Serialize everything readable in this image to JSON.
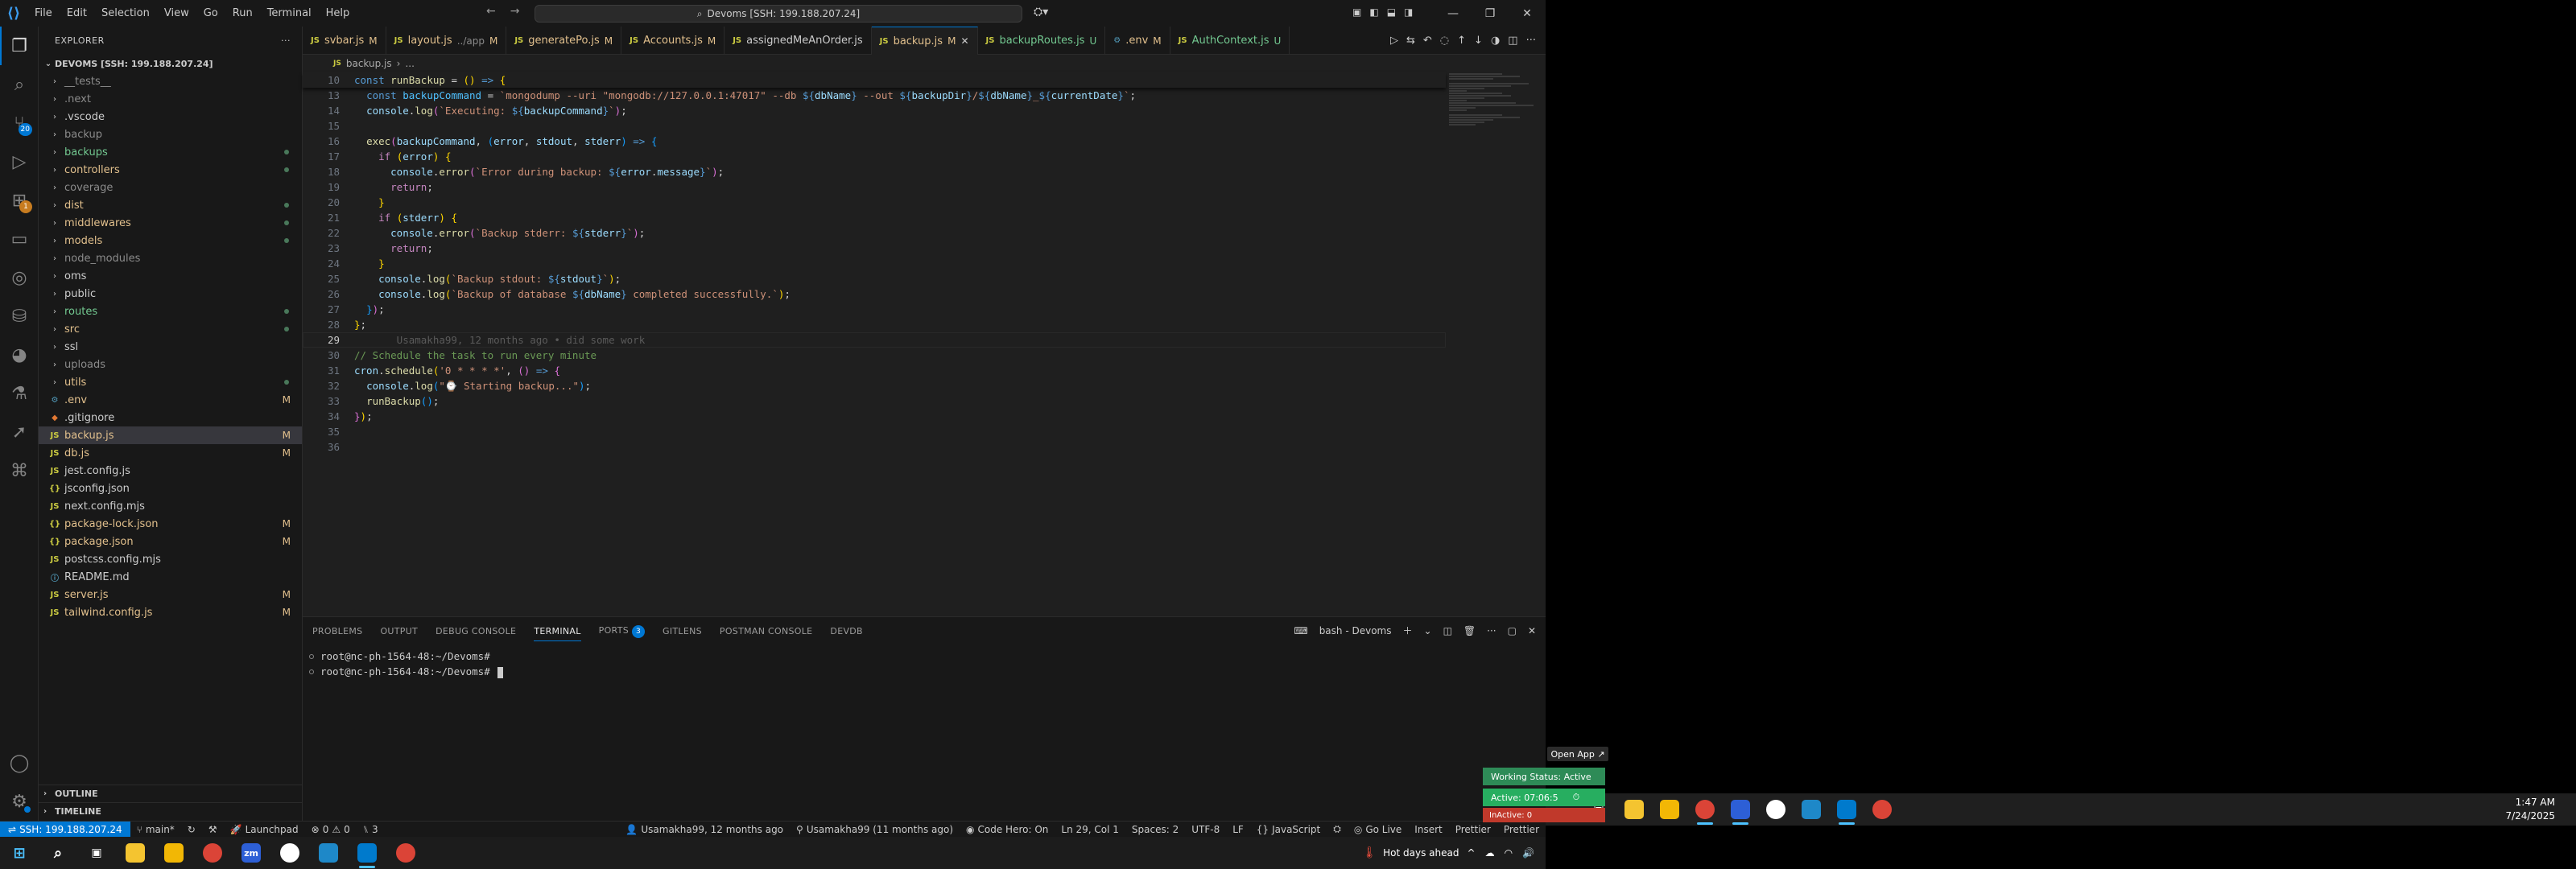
{
  "titlebar": {
    "menus": [
      "File",
      "Edit",
      "Selection",
      "View",
      "Go",
      "Run",
      "Terminal",
      "Help"
    ],
    "command_center": "Devoms [SSH: 199.188.207.24]"
  },
  "activity": {
    "source_control_badge": "20",
    "extensions_badge": "1"
  },
  "explorer": {
    "title": "EXPLORER",
    "root": "DEVOMS [SSH: 199.188.207.24]",
    "items": [
      {
        "type": "folder",
        "name": "__tests__",
        "color": "#8b8b8b",
        "status": ""
      },
      {
        "type": "folder",
        "name": ".next",
        "color": "#8b8b8b",
        "status": ""
      },
      {
        "type": "folder",
        "name": ".vscode",
        "color": "#cccccc",
        "status": ""
      },
      {
        "type": "folder",
        "name": "backup",
        "color": "#8b8b8b",
        "status": ""
      },
      {
        "type": "folder",
        "name": "backups",
        "color": "#73c991",
        "status": "dot"
      },
      {
        "type": "folder",
        "name": "controllers",
        "color": "#e2c08d",
        "status": "dot"
      },
      {
        "type": "folder",
        "name": "coverage",
        "color": "#8b8b8b",
        "status": ""
      },
      {
        "type": "folder",
        "name": "dist",
        "color": "#e2c08d",
        "status": "dot"
      },
      {
        "type": "folder",
        "name": "middlewares",
        "color": "#e2c08d",
        "status": "dot"
      },
      {
        "type": "folder",
        "name": "models",
        "color": "#e2c08d",
        "status": "dot"
      },
      {
        "type": "folder",
        "name": "node_modules",
        "color": "#8b8b8b",
        "status": ""
      },
      {
        "type": "folder",
        "name": "oms",
        "color": "#cccccc",
        "status": ""
      },
      {
        "type": "folder",
        "name": "public",
        "color": "#cccccc",
        "status": ""
      },
      {
        "type": "folder",
        "name": "routes",
        "color": "#73c991",
        "status": "dot"
      },
      {
        "type": "folder",
        "name": "src",
        "color": "#e2c08d",
        "status": "dot"
      },
      {
        "type": "folder",
        "name": "ssl",
        "color": "#cccccc",
        "status": ""
      },
      {
        "type": "folder",
        "name": "uploads",
        "color": "#8b8b8b",
        "status": ""
      },
      {
        "type": "folder",
        "name": "utils",
        "color": "#e2c08d",
        "status": "dot"
      },
      {
        "type": "file",
        "name": ".env",
        "icon": "⚙",
        "icon_color": "#519aba",
        "color": "#e2c08d",
        "status": "M"
      },
      {
        "type": "file",
        "name": ".gitignore",
        "icon": "◆",
        "icon_color": "#e37933",
        "color": "#cccccc",
        "status": ""
      },
      {
        "type": "file",
        "name": "backup.js",
        "icon": "JS",
        "icon_color": "#cbcb41",
        "color": "#e2c08d",
        "status": "M",
        "selected": true
      },
      {
        "type": "file",
        "name": "db.js",
        "icon": "JS",
        "icon_color": "#cbcb41",
        "color": "#e2c08d",
        "status": "M"
      },
      {
        "type": "file",
        "name": "jest.config.js",
        "icon": "JS",
        "icon_color": "#cbcb41",
        "color": "#cccccc",
        "status": ""
      },
      {
        "type": "file",
        "name": "jsconfig.json",
        "icon": "{}",
        "icon_color": "#cbcb41",
        "color": "#cccccc",
        "status": ""
      },
      {
        "type": "file",
        "name": "next.config.mjs",
        "icon": "JS",
        "icon_color": "#cbcb41",
        "color": "#cccccc",
        "status": ""
      },
      {
        "type": "file",
        "name": "package-lock.json",
        "icon": "{}",
        "icon_color": "#cbcb41",
        "color": "#e2c08d",
        "status": "M"
      },
      {
        "type": "file",
        "name": "package.json",
        "icon": "{}",
        "icon_color": "#cbcb41",
        "color": "#e2c08d",
        "status": "M"
      },
      {
        "type": "file",
        "name": "postcss.config.mjs",
        "icon": "JS",
        "icon_color": "#cbcb41",
        "color": "#cccccc",
        "status": ""
      },
      {
        "type": "file",
        "name": "README.md",
        "icon": "ⓘ",
        "icon_color": "#519aba",
        "color": "#cccccc",
        "status": ""
      },
      {
        "type": "file",
        "name": "server.js",
        "icon": "JS",
        "icon_color": "#cbcb41",
        "color": "#e2c08d",
        "status": "M"
      },
      {
        "type": "file",
        "name": "tailwind.config.js",
        "icon": "JS",
        "icon_color": "#cbcb41",
        "color": "#e2c08d",
        "status": "M"
      }
    ],
    "outline": "OUTLINE",
    "timeline": "TIMELINE"
  },
  "tabs": [
    {
      "name": "svbar.js",
      "desc": "",
      "mark": "M",
      "icon": "JS",
      "icon_color": "#cbcb41",
      "color": "#e2c08d"
    },
    {
      "name": "layout.js",
      "desc": "../app",
      "mark": "M",
      "icon": "JS",
      "icon_color": "#cbcb41",
      "color": "#e2c08d"
    },
    {
      "name": "generatePo.js",
      "desc": "",
      "mark": "M",
      "icon": "JS",
      "icon_color": "#cbcb41",
      "color": "#e2c08d"
    },
    {
      "name": "Accounts.js",
      "desc": "",
      "mark": "M",
      "icon": "JS",
      "icon_color": "#cbcb41",
      "color": "#e2c08d"
    },
    {
      "name": "assignedMeAnOrder.js",
      "desc": "",
      "mark": "",
      "icon": "JS",
      "icon_color": "#cbcb41",
      "color": "#cccccc"
    },
    {
      "name": "backup.js",
      "desc": "",
      "mark": "M",
      "icon": "JS",
      "icon_color": "#cbcb41",
      "color": "#e2c08d",
      "active": true
    },
    {
      "name": "backupRoutes.js",
      "desc": "",
      "mark": "U",
      "icon": "JS",
      "icon_color": "#cbcb41",
      "color": "#73c991"
    },
    {
      "name": ".env",
      "desc": "",
      "mark": "M",
      "icon": "⚙",
      "icon_color": "#519aba",
      "color": "#e2c08d"
    },
    {
      "name": "AuthContext.js",
      "desc": "",
      "mark": "U",
      "icon": "JS",
      "icon_color": "#cbcb41",
      "color": "#73c991"
    }
  ],
  "breadcrumb": {
    "file": "backup.js",
    "rest": "..."
  },
  "editor": {
    "sticky": {
      "ln": "10",
      "html": "<span class='k'>const</span> <span class='f'>runBackup</span> <span class='p'>=</span> <span class='y'>()</span> <span class='k'>=&gt;</span> <span class='y'>{</span>"
    },
    "lines": [
      {
        "ln": "13",
        "html": "  <span class='k'>const</span> <span class='cn'>backupCommand</span> <span class='p'>=</span> <span class='s'>`mongodump --uri \"mongodb://127.0.0.1:47017\" --db </span><span class='cs'>${</span><span class='v'>dbName</span><span class='cs'>}</span><span class='s'> --out </span><span class='cs'>${</span><span class='v'>backupDir</span><span class='cs'>}</span><span class='s'>/</span><span class='cs'>${</span><span class='v'>dbName</span><span class='cs'>}</span><span class='s'>_</span><span class='cs'>${</span><span class='v'>currentDate</span><span class='cs'>}</span><span class='s'>`</span><span class='p'>;</span>"
      },
      {
        "ln": "14",
        "html": "  <span class='v'>console</span><span class='p'>.</span><span class='f'>log</span><span class='pu'>(</span><span class='s'>`Executing: </span><span class='cs'>${</span><span class='v'>backupCommand</span><span class='cs'>}</span><span class='s'>`</span><span class='pu'>)</span><span class='p'>;</span>"
      },
      {
        "ln": "15",
        "html": ""
      },
      {
        "ln": "16",
        "html": "  <span class='f'>exec</span><span class='pu'>(</span><span class='v'>backupCommand</span><span class='p'>,</span> <span class='bl'>(</span><span class='v'>error</span><span class='p'>,</span> <span class='v'>stdout</span><span class='p'>,</span> <span class='v'>stderr</span><span class='bl'>)</span> <span class='k'>=&gt;</span> <span class='bl'>{</span>"
      },
      {
        "ln": "17",
        "html": "    <span class='kw'>if</span> <span class='y'>(</span><span class='v'>error</span><span class='y'>)</span> <span class='y'>{</span>"
      },
      {
        "ln": "18",
        "html": "      <span class='v'>console</span><span class='p'>.</span><span class='f'>error</span><span class='pu'>(</span><span class='s'>`Error during backup: </span><span class='cs'>${</span><span class='v'>error</span><span class='p'>.</span><span class='v'>message</span><span class='cs'>}</span><span class='s'>`</span><span class='pu'>)</span><span class='p'>;</span>"
      },
      {
        "ln": "19",
        "html": "      <span class='kw'>return</span><span class='p'>;</span>"
      },
      {
        "ln": "20",
        "html": "    <span class='y'>}</span>"
      },
      {
        "ln": "21",
        "html": "    <span class='kw'>if</span> <span class='y'>(</span><span class='v'>stderr</span><span class='y'>)</span> <span class='y'>{</span>"
      },
      {
        "ln": "22",
        "html": "      <span class='v'>console</span><span class='p'>.</span><span class='f'>error</span><span class='pu'>(</span><span class='s'>`Backup stderr: </span><span class='cs'>${</span><span class='v'>stderr</span><span class='cs'>}</span><span class='s'>`</span><span class='pu'>)</span><span class='p'>;</span>"
      },
      {
        "ln": "23",
        "html": "      <span class='kw'>return</span><span class='p'>;</span>"
      },
      {
        "ln": "24",
        "html": "    <span class='y'>}</span>"
      },
      {
        "ln": "25",
        "html": "    <span class='v'>console</span><span class='p'>.</span><span class='f'>log</span><span class='y'>(</span><span class='s'>`Backup stdout: </span><span class='cs'>${</span><span class='v'>stdout</span><span class='cs'>}</span><span class='s'>`</span><span class='y'>)</span><span class='p'>;</span>"
      },
      {
        "ln": "26",
        "html": "    <span class='v'>console</span><span class='p'>.</span><span class='f'>log</span><span class='y'>(</span><span class='s'>`Backup of database </span><span class='cs'>${</span><span class='v'>dbName</span><span class='cs'>}</span><span class='s'> completed successfully.`</span><span class='y'>)</span><span class='p'>;</span>"
      },
      {
        "ln": "27",
        "html": "  <span class='bl'>}</span><span class='pu'>)</span><span class='p'>;</span>"
      },
      {
        "ln": "28",
        "html": "<span class='y'>}</span><span class='p'>;</span>"
      },
      {
        "ln": "29",
        "html": "<span style='color:#5a5a5a'>       Usamakha99, 12 months ago • did some work</span>",
        "current": true
      },
      {
        "ln": "30",
        "html": "<span class='c'>// Schedule the task to run every minute</span>"
      },
      {
        "ln": "31",
        "html": "<span class='v'>cron</span><span class='p'>.</span><span class='f'>schedule</span><span class='y'>(</span><span class='s'>'0 * * * *'</span><span class='p'>,</span> <span class='pu'>()</span> <span class='k'>=&gt;</span> <span class='pu'>{</span>"
      },
      {
        "ln": "32",
        "html": "  <span class='v'>console</span><span class='p'>.</span><span class='f'>log</span><span class='bl'>(</span><span class='s'>\"⌚ Starting backup...\"</span><span class='bl'>)</span><span class='p'>;</span>"
      },
      {
        "ln": "33",
        "html": "  <span class='f'>runBackup</span><span class='bl'>()</span><span class='p'>;</span>"
      },
      {
        "ln": "34",
        "html": "<span class='pu'>}</span><span class='y'>)</span><span class='p'>;</span>"
      },
      {
        "ln": "35",
        "html": ""
      },
      {
        "ln": "36",
        "html": ""
      }
    ]
  },
  "panel": {
    "tabs": [
      "PROBLEMS",
      "OUTPUT",
      "DEBUG CONSOLE",
      "TERMINAL",
      "PORTS",
      "GITLENS",
      "POSTMAN CONSOLE",
      "DEVDB"
    ],
    "active_tab": "TERMINAL",
    "ports_badge": "3",
    "terminal_name": "bash - Devoms",
    "lines": [
      "root@nc-ph-1564-48:~/Devoms# ",
      "root@nc-ph-1564-48:~/Devoms# "
    ]
  },
  "statusbar": {
    "remote": "SSH: 199.188.207.24",
    "branch": "main*",
    "launchpad": "Launchpad",
    "problems_errors": "0",
    "problems_warnings": "0",
    "ports": "3",
    "blame": "Usamakha99, 12 months ago",
    "author": "Usamakha99 (11 months ago)",
    "code_hero": "Code Hero: On",
    "position": "Ln 29, Col 1",
    "spaces": "Spaces: 2",
    "encoding": "UTF-8",
    "eol": "LF",
    "language": "JavaScript",
    "golive": "Go Live",
    "insert": "Insert",
    "prettier1": "Prettier",
    "prettier2": "Prettier"
  },
  "taskbar": {
    "weather": "Hot days ahead",
    "zm_label": "zm"
  },
  "taskbar2": {
    "time": "1:47 AM",
    "date": "7/24/2025"
  },
  "tracker": {
    "open_app": "Open App ↗",
    "working_status": "Working Status: Active",
    "active_time": "Active: 07:06:5",
    "inactive": "InActive: 0"
  },
  "colors": {
    "accent": "#0078d4",
    "modified": "#e2c08d",
    "untracked": "#73c991"
  }
}
